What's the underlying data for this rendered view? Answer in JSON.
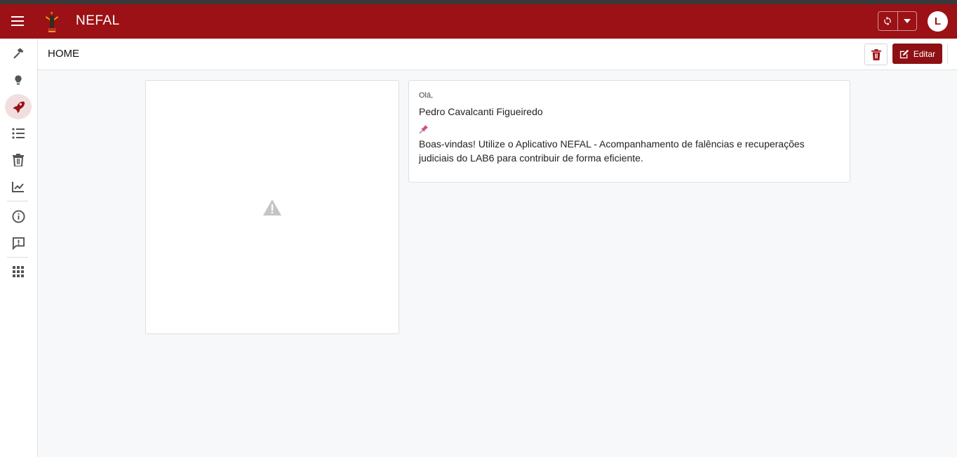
{
  "app": {
    "title": "NEFAL"
  },
  "user": {
    "avatar_initial": "L"
  },
  "header": {
    "title": "HOME",
    "edit_label": "Editar"
  },
  "sidebar": {
    "items": [
      {
        "icon": "hammer-icon"
      },
      {
        "icon": "lightbulb-icon"
      },
      {
        "icon": "rocket-icon",
        "active": true
      },
      {
        "icon": "list-icon"
      },
      {
        "icon": "trash-icon"
      },
      {
        "icon": "chart-line-icon"
      },
      {
        "icon": "info-icon"
      },
      {
        "icon": "feedback-icon"
      },
      {
        "icon": "apps-grid-icon"
      }
    ]
  },
  "welcome": {
    "greeting": "Olá,",
    "name": "Pedro Cavalcanti Figueiredo",
    "message": "Boas-vindas! Utilize o Aplicativo NEFAL - Acompanhamento de falências e recuperações judiciais do LAB6 para contribuir de forma eficiente."
  },
  "colors": {
    "brand": "#9b1115",
    "active_bg": "#f1dfe0",
    "background": "#f7f8f9"
  }
}
